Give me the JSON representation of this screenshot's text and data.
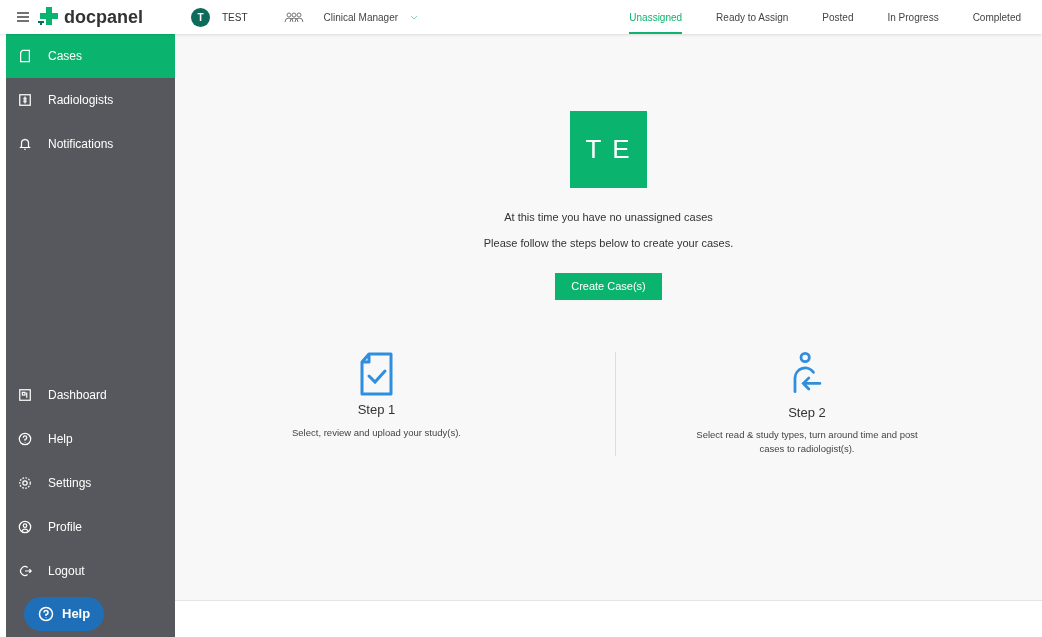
{
  "header": {
    "brand": "docpanel",
    "account": {
      "initial": "T",
      "name": "TEST"
    },
    "role": "Clinical Manager",
    "tabs": [
      {
        "label": "Unassigned",
        "selected": true
      },
      {
        "label": "Ready to Assign",
        "selected": false
      },
      {
        "label": "Posted",
        "selected": false
      },
      {
        "label": "In Progress",
        "selected": false
      },
      {
        "label": "Completed",
        "selected": false
      }
    ]
  },
  "sidebar": {
    "top_items": [
      {
        "label": "Cases",
        "kind": "cases",
        "selected": true
      },
      {
        "label": "Radiologists",
        "kind": "radiologists",
        "selected": false
      },
      {
        "label": "Notifications",
        "kind": "notifications",
        "selected": false
      }
    ],
    "bottom_items": [
      {
        "label": "Dashboard",
        "kind": "dashboard",
        "selected": false
      },
      {
        "label": "Help",
        "kind": "help",
        "selected": false
      },
      {
        "label": "Settings",
        "kind": "settings",
        "selected": false
      },
      {
        "label": "Profile",
        "kind": "profile",
        "selected": false
      },
      {
        "label": "Logout",
        "kind": "logout",
        "selected": false
      }
    ],
    "help_button": "Help"
  },
  "main": {
    "avatar": "T E",
    "message": "At this time you have no unassigned cases",
    "instruction": "Please follow the steps below to create your cases.",
    "create_button": "Create Case(s)",
    "steps": [
      {
        "kind": "document",
        "title": "Step 1",
        "text": "Select, review and upload your study(s)."
      },
      {
        "kind": "person",
        "title": "Step 2",
        "text": "Select read & study types, turn around time and post cases to radiologist(s)."
      }
    ]
  }
}
